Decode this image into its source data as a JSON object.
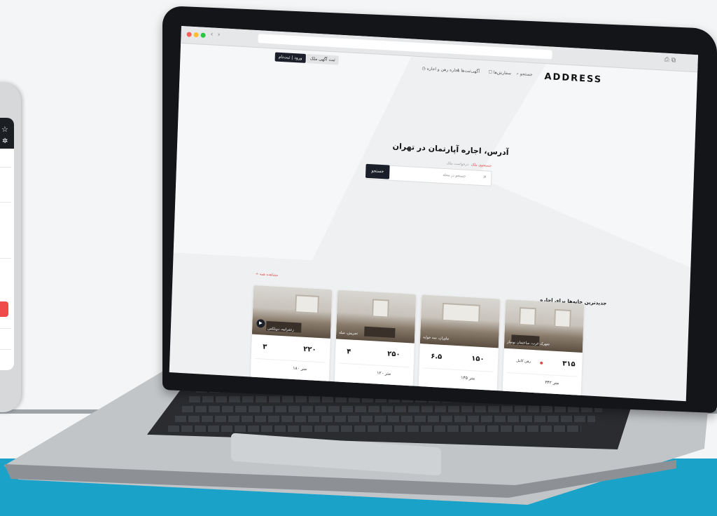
{
  "browser": {
    "nav_back": "‹",
    "nav_forward": "›",
    "right_icons": "⎙ ⧉"
  },
  "site": {
    "logo": "ADDRESS",
    "nav": [
      {
        "label": "جستجو"
      },
      {
        "label": "سفارش‌ها"
      },
      {
        "label": "آگهی‌ثبت‌ها"
      },
      {
        "label": "اجاره رهن و اجاره"
      }
    ],
    "btn_login": "ورود | ثبت‌نام",
    "btn_post": "ثبت آگهی ملک"
  },
  "hero": {
    "title": "آدرس، اجاره آپارتمان در تهران",
    "tab_active": "جستجوی ملک",
    "tab_inactive": "درخواست ملک",
    "search_placeholder": "جستجو در محله",
    "search_button": "جستجو"
  },
  "listings": {
    "section_title": "جدیدترین خانه‌ها برای اجاره",
    "see_all": "مشاهده همه",
    "cards": [
      {
        "label": "شهرک غرب، ساختمان نوساز",
        "price_a": "۳۱۵",
        "price_b": "رهن کامل",
        "foot": "۳۴۲ متر"
      },
      {
        "label": "نیاوران، سه خوابه",
        "price_a": "۱۵۰",
        "price_b": "۶.۵",
        "foot": "۱۴۵ متر"
      },
      {
        "label": "تجریش، مبله",
        "price_a": "۲۵۰",
        "price_b": "۴",
        "foot": "۱۲۰ متر"
      },
      {
        "label": "زعفرانیه، دوبلکس",
        "price_a": "۲۲۰",
        "price_b": "۳",
        "foot": "۱۸۰ متر"
      }
    ]
  },
  "colors": {
    "accent_red": "#e04a4a",
    "dark_button": "#1b1f2a",
    "teal_band": "#1aa2c9"
  }
}
